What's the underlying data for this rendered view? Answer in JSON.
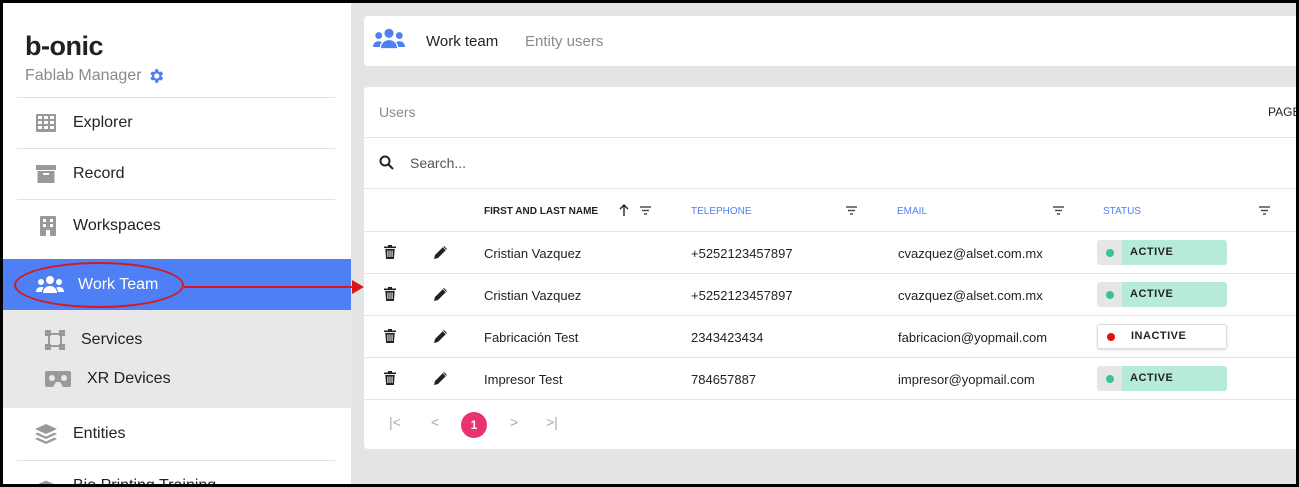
{
  "brand": {
    "name": "b-onic",
    "subtitle": "Fablab Manager",
    "subtitle_icon": "gear-icon"
  },
  "sidebar": {
    "items": [
      {
        "label": "Explorer",
        "icon": "grid-icon"
      },
      {
        "label": "Record",
        "icon": "archive-icon"
      },
      {
        "label": "Workspaces",
        "icon": "building-icon"
      }
    ],
    "active": {
      "label": "Work Team",
      "icon": "users-icon"
    },
    "sub_items": [
      {
        "label": "Services",
        "icon": "nodes-icon"
      },
      {
        "label": "XR Devices",
        "icon": "vr-headset-icon"
      }
    ],
    "lower_items": [
      {
        "label": "Entities",
        "icon": "layers-icon"
      },
      {
        "label": "Bio Printing Training",
        "icon": "graduation-cap-icon"
      }
    ]
  },
  "tabs": [
    {
      "label": "Work team",
      "active": true
    },
    {
      "label": "Entity users",
      "active": false
    }
  ],
  "panel": {
    "title": "Users",
    "page_label": "PAGE",
    "search_placeholder": "Search..."
  },
  "table": {
    "columns": [
      "FIRST AND LAST NAME",
      "TELEPHONE",
      "EMAIL",
      "STATUS"
    ],
    "rows": [
      {
        "name": "Cristian Vazquez",
        "telephone": "+5252123457897",
        "email": "cvazquez@alset.com.mx",
        "status": "ACTIVE"
      },
      {
        "name": "Cristian Vazquez",
        "telephone": "+5252123457897",
        "email": "cvazquez@alset.com.mx",
        "status": "ACTIVE"
      },
      {
        "name": "Fabricación Test",
        "telephone": "2343423434",
        "email": "fabricacion@yopmail.com",
        "status": "INACTIVE"
      },
      {
        "name": "Impresor Test",
        "telephone": "784657887",
        "email": "impresor@yopmail.com",
        "status": "ACTIVE"
      }
    ]
  },
  "pagination": {
    "first": "|<",
    "prev": "<",
    "current": "1",
    "next": ">",
    "last": ">|"
  },
  "colors": {
    "accent": "#4f7ff5",
    "active_status": "#b6ecd7",
    "active_dot": "#3cc48f",
    "inactive_dot": "#e01010",
    "page_badge": "#e8336f",
    "annotation": "#d81818"
  }
}
